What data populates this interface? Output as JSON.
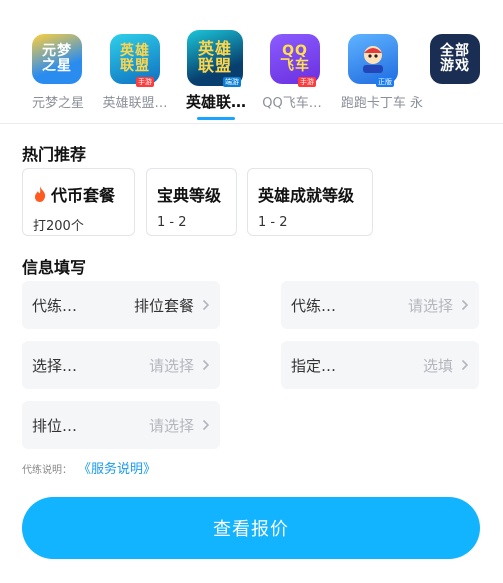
{
  "games": [
    {
      "tile_lines": [
        "元梦",
        "之星"
      ],
      "label": "元梦之星",
      "color": "#2b8cf0"
    },
    {
      "tile_lines": [
        "英雄",
        "联盟"
      ],
      "label": "英雄联盟…",
      "color": "#0f8bd6"
    },
    {
      "tile_lines": [
        "英雄",
        "联盟"
      ],
      "label": "英雄联…",
      "color": "#083f6e",
      "active": true
    },
    {
      "tile_lines": [
        "QQ",
        "飞车"
      ],
      "label": "QQ飞车…",
      "color": "#7a3cf0"
    },
    {
      "tile_lines": [
        "跑跑",
        "卡丁"
      ],
      "label": "跑跑卡丁车 永",
      "color": "#2a7df5"
    },
    {
      "tile_lines": [
        "全部",
        "游戏"
      ],
      "label": "",
      "color": "#1a2d52"
    }
  ],
  "badges": {
    "g1": "手游",
    "g2": "端游",
    "g3": "手游",
    "g4": "正版"
  },
  "recommend": {
    "title": "热门推荐",
    "packages": [
      {
        "name": "代币套餐",
        "sub": "打200个"
      },
      {
        "name": "宝典等级",
        "sub": "1 - 2"
      },
      {
        "name": "英雄成就等级",
        "sub": "1 - 2"
      }
    ]
  },
  "form": {
    "title": "信息填写",
    "fields": [
      {
        "label": "代练…",
        "value": "排位套餐"
      },
      {
        "label": "代练…",
        "value": "请选择"
      },
      {
        "label": "选择…",
        "value": "请选择"
      },
      {
        "label": "指定…",
        "value": "选填"
      },
      {
        "label": "排位…",
        "value": "请选择"
      }
    ]
  },
  "note": {
    "label": "代练说明：",
    "link": "《服务说明》"
  },
  "cta": "查看报价",
  "colors": {
    "accent": "#12b4ff",
    "link": "#1a9bf0",
    "flame": "#ff5a1f"
  }
}
